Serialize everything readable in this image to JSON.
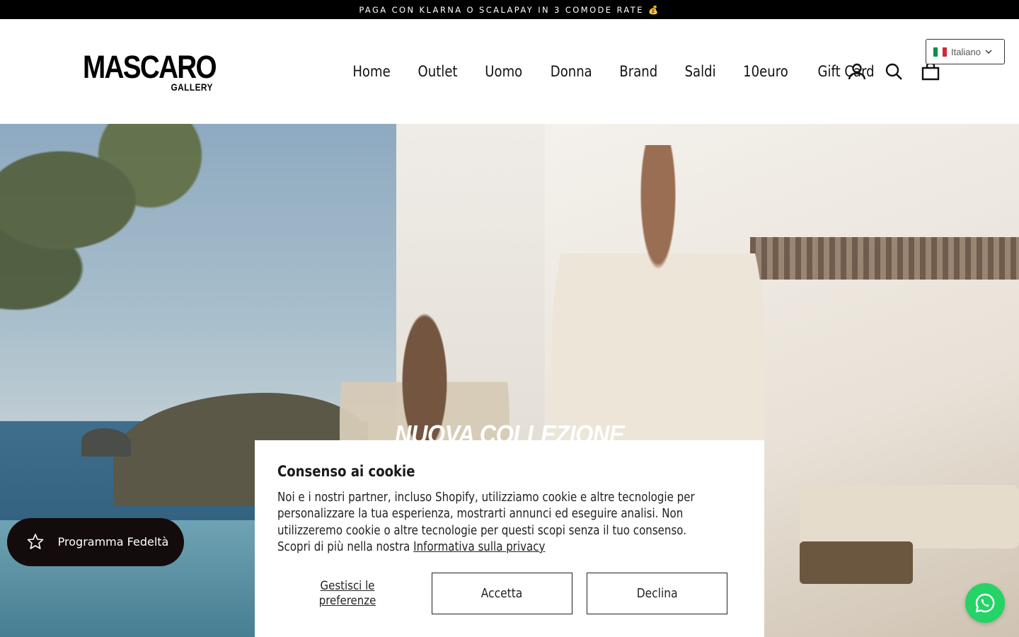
{
  "announcement": {
    "text": "PAGA CON KLARNA O SCALAPAY IN 3 COMODE RATE 💰"
  },
  "logo": {
    "main": "MASCARO",
    "sub": "GALLERY"
  },
  "nav": {
    "items": [
      {
        "label": "Home"
      },
      {
        "label": "Outlet"
      },
      {
        "label": "Uomo"
      },
      {
        "label": "Donna"
      },
      {
        "label": "Brand"
      },
      {
        "label": "Saldi"
      },
      {
        "label": "10euro"
      },
      {
        "label": "Gift Card"
      }
    ],
    "icons": [
      "account-icon",
      "search-icon",
      "cart-icon"
    ]
  },
  "language": {
    "selected": "Italiano",
    "flag_colors": [
      "#009246",
      "#ffffff",
      "#ce2b37"
    ]
  },
  "hero": {
    "title": "NUOVA COLLEZIONE"
  },
  "cookie": {
    "title": "Consenso ai cookie",
    "body": "Noi e i nostri partner, incluso Shopify, utilizziamo cookie e altre tecnologie per personalizzare la tua esperienza, mostrarti annunci ed eseguire analisi. Non utilizzeremo cookie o altre tecnologie per questi scopi senza il tuo consenso. Scopri di più nella nostra",
    "privacy_link": "Informativa sulla privacy",
    "manage_label": "Gestisci le preferenze",
    "accept_label": "Accetta",
    "decline_label": "Declina"
  },
  "loyalty": {
    "label": "Programma Fedeltà",
    "color": "#140c0c"
  },
  "whatsapp": {
    "color": "#25d366"
  }
}
